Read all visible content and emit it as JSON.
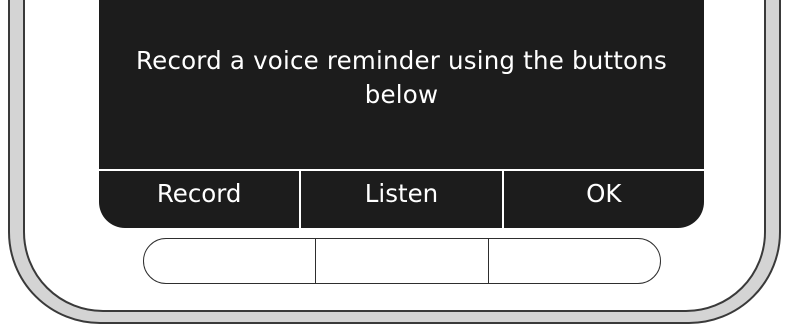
{
  "screen": {
    "prompt": "Record a voice reminder using the buttons below",
    "softkeys": [
      {
        "label": "Record"
      },
      {
        "label": "Listen"
      },
      {
        "label": "OK"
      }
    ]
  },
  "colors": {
    "screen_background": "#1c1c1c",
    "screen_text": "#ffffff",
    "device_bezel": "#d4d4d4",
    "device_outline": "#3a3a3a"
  }
}
